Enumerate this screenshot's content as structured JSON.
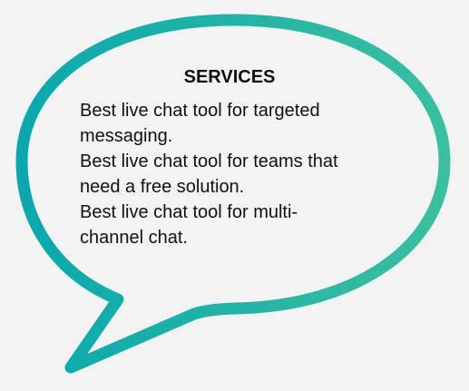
{
  "colors": {
    "background": "#f3f3f3",
    "bubble_fill": "#f3f3f3",
    "bubble_stroke_start": "#0aa8ac",
    "bubble_stroke_end": "#3bbfa0",
    "text": "#111111"
  },
  "bubble": {
    "title": "SERVICES",
    "lines": [
      "Best live chat tool for targeted",
      "messaging.",
      "Best live chat tool for teams that",
      "need a free solution.",
      "Best live chat tool for multi-",
      "channel chat."
    ]
  }
}
